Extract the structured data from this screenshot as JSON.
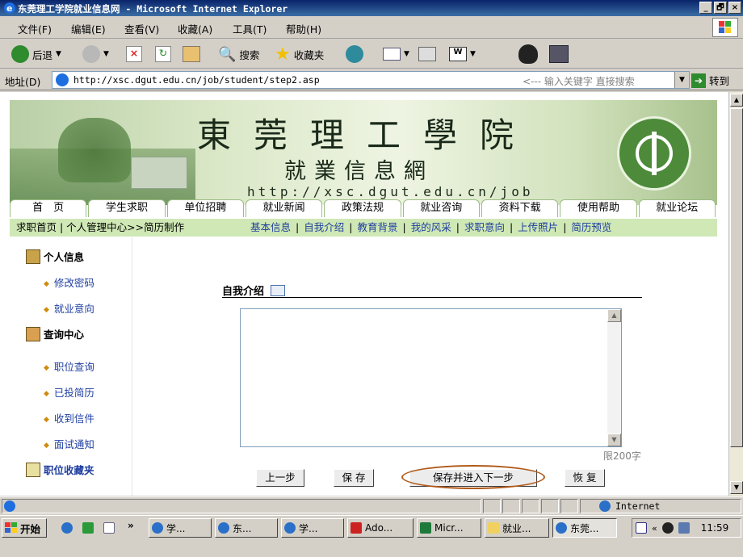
{
  "window": {
    "title": "东莞理工学院就业信息网 - Microsoft Internet Explorer",
    "buttons": [
      "_",
      "🗗",
      "×"
    ]
  },
  "menu": [
    "文件(F)",
    "编辑(E)",
    "查看(V)",
    "收藏(A)",
    "工具(T)",
    "帮助(H)"
  ],
  "toolbar": {
    "back": "后退",
    "search": "搜索",
    "favorites": "收藏夹"
  },
  "address": {
    "label": "地址(D)",
    "url": "http://xsc.dgut.edu.cn/job/student/step2.asp",
    "hint": "<--- 输入关键字 直接搜索",
    "go": "转到"
  },
  "banner": {
    "university": "東莞理工學院",
    "subtitle": "就業信息網",
    "url": "http://xsc.dgut.edu.cn/job"
  },
  "nav": [
    "首　页",
    "学生求职",
    "单位招聘",
    "就业新闻",
    "政策法规",
    "就业咨询",
    "资料下载",
    "使用帮助",
    "就业论坛"
  ],
  "subnav": {
    "crumb": "求职首页 | 个人管理中心>>简历制作",
    "links": [
      "基本信息",
      "自我介绍",
      "教育背景",
      "我的风采",
      "求职意向",
      "上传照片",
      "简历预览"
    ]
  },
  "sidebar": {
    "groups": [
      {
        "title": "个人信息",
        "items": [
          "修改密码",
          "就业意向"
        ]
      },
      {
        "title": "查询中心",
        "items": [
          "职位查询",
          "已投简历",
          "收到信件",
          "面试通知"
        ]
      },
      {
        "title": "职位收藏夹",
        "items": []
      }
    ]
  },
  "form": {
    "section_title": "自我介绍",
    "textarea_value": "",
    "limit": "限200字",
    "buttons": {
      "prev": "上一步",
      "save": "保 存",
      "save_next": "保存并进入下一步",
      "restore": "恢 复"
    }
  },
  "status": {
    "zone": "Internet"
  },
  "taskbar": {
    "start": "开始",
    "chevron": "»",
    "tasks": [
      "学...",
      "东...",
      "学...",
      "Ado...",
      "Micr...",
      "就业...",
      "东莞..."
    ],
    "clock": "11:59"
  },
  "colors": {
    "titlebar": "#0a246a",
    "subnav_bg": "#cfe8b5",
    "link": "#1f3fa0",
    "highlight": "#b05a1a"
  }
}
